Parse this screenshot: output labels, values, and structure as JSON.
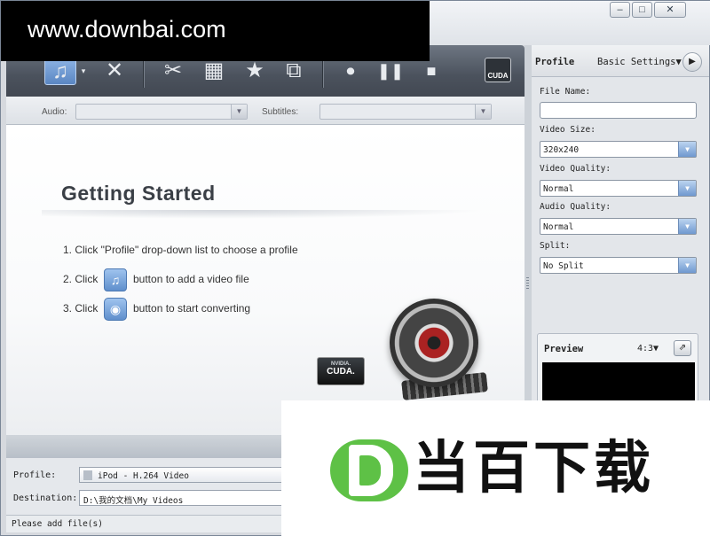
{
  "watermark": {
    "text": "www.downbai.com"
  },
  "window_controls": {
    "minimize": "–",
    "maximize": "□",
    "close": "✕"
  },
  "toolbar": {
    "add_file": "♫",
    "remove": "✕",
    "trim": "✂",
    "crop": "▦",
    "effect": "★",
    "merge": "⧉",
    "record": "⏺",
    "pause": "❚❚",
    "stop": "■",
    "cuda": "CUDA"
  },
  "av_bar": {
    "audio_label": "Audio:",
    "subtitles_label": "Subtitles:"
  },
  "getting_started": {
    "title": "Getting Started",
    "step1": "1. Click \"Profile\" drop-down list to choose a profile",
    "step2_prefix": "2. Click",
    "step2_suffix": "button to add a video file",
    "step3_prefix": "3. Click",
    "step3_suffix": "button to start converting",
    "cuda_logo_brand": "NVIDIA.",
    "cuda_logo_text": "CUDA."
  },
  "bottom": {
    "profile_label": "Profile:",
    "profile_value": "iPod - H.264 Video",
    "destination_label": "Destination:",
    "destination_value": "D:\\我的文档\\My Videos"
  },
  "status": {
    "text": "Please add file(s)"
  },
  "right_panel": {
    "profile_tab": "Profile",
    "basic_settings": "Basic Settings▼",
    "next_icon": "▶",
    "file_name_label": "File Name:",
    "file_name_value": "",
    "video_size_label": "Video Size:",
    "video_size_value": "320x240",
    "video_quality_label": "Video Quality:",
    "video_quality_value": "Normal",
    "audio_quality_label": "Audio Quality:",
    "audio_quality_value": "Normal",
    "split_label": "Split:",
    "split_value": "No Split",
    "preview_label": "Preview",
    "preview_ratio": "4:3▼",
    "snapshot_icon": "⇗"
  },
  "overlay": {
    "logo_text": "当百下载"
  }
}
